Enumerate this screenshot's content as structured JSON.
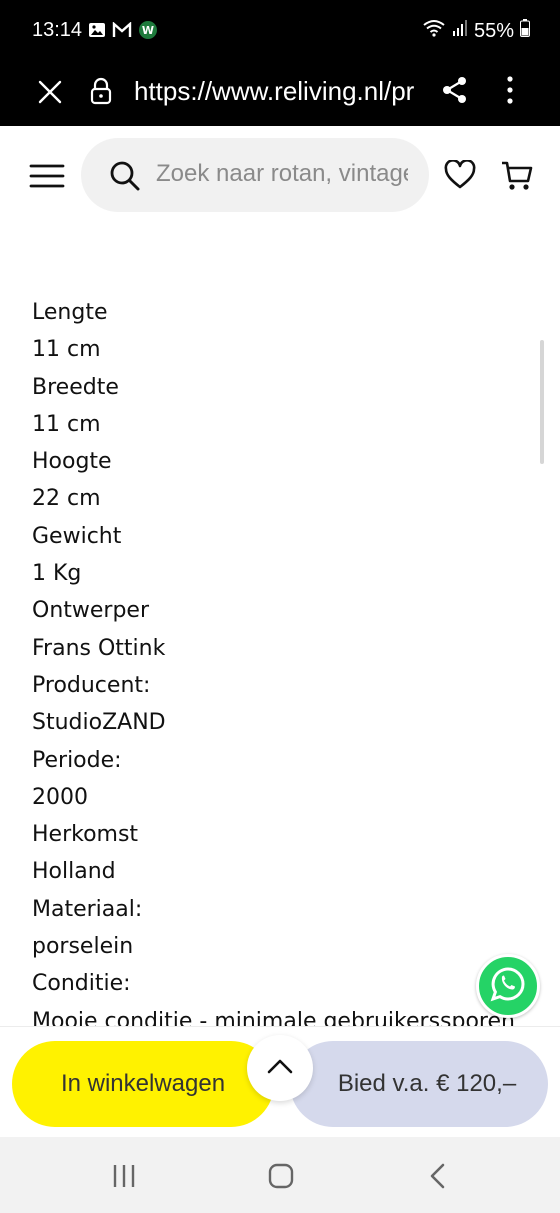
{
  "status_bar": {
    "time": "13:14",
    "battery": "55%",
    "left_icons": [
      "gallery-icon",
      "gmail-icon",
      "app-w-icon"
    ],
    "right_icons": [
      "wifi-icon",
      "signal-icon",
      "battery-icon"
    ]
  },
  "browser": {
    "url": "https://www.reliving.nl/pr",
    "icons": [
      "close-icon",
      "lock-icon",
      "share-icon",
      "more-vert-icon"
    ]
  },
  "header": {
    "search_placeholder": "Zoek naar rotan, vintage",
    "icons": [
      "menu-icon",
      "search-icon",
      "heart-icon",
      "cart-icon"
    ]
  },
  "specs": [
    "Lengte",
    "11 cm",
    "Breedte",
    "11 cm",
    "Hoogte",
    "22 cm",
    "Gewicht",
    "1 Kg",
    "Ontwerper",
    "Frans Ottink",
    "Producent:",
    "StudioZAND",
    "Periode:",
    "2000",
    "Herkomst",
    "Holland",
    "Materiaal:",
    "porselein",
    "Conditie:",
    "Mooie conditie - minimale gebruikerssporen"
  ],
  "actions": {
    "add_to_cart": "In winkelwagen",
    "bid": "Bied v.a. € 120,–",
    "scroll_top_icon": "chevron-up-icon",
    "whatsapp_icon": "whatsapp-icon"
  },
  "colors": {
    "cart_button": "#fff200",
    "bid_button": "#d5d9ec",
    "whatsapp": "#25d366"
  },
  "system_nav": [
    "recents-icon",
    "home-icon",
    "back-icon"
  ]
}
